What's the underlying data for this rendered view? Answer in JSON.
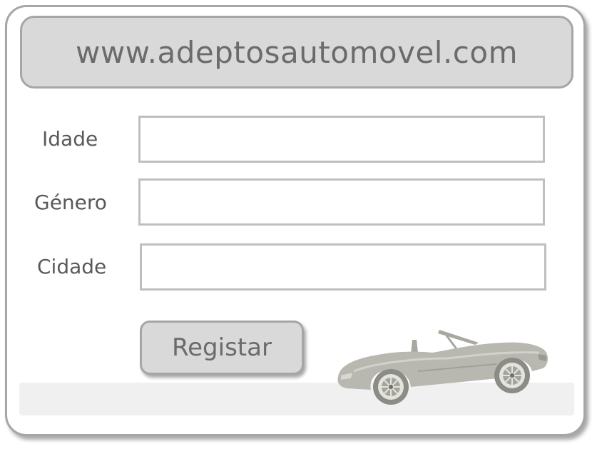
{
  "header": {
    "site_url": "www.adeptosautomovel.com"
  },
  "form": {
    "fields": [
      {
        "label": "Idade",
        "value": "",
        "placeholder": ""
      },
      {
        "label": "Género",
        "value": "",
        "placeholder": ""
      },
      {
        "label": "Cidade",
        "value": "",
        "placeholder": ""
      }
    ],
    "submit_label": "Registar"
  },
  "decor": {
    "illustration_icon": "convertible-car-icon"
  },
  "colors": {
    "panel_fill": "#d9d9d9",
    "border": "#a6a6a6",
    "text": "#6b6b6b",
    "car": "#b8b8b0"
  }
}
